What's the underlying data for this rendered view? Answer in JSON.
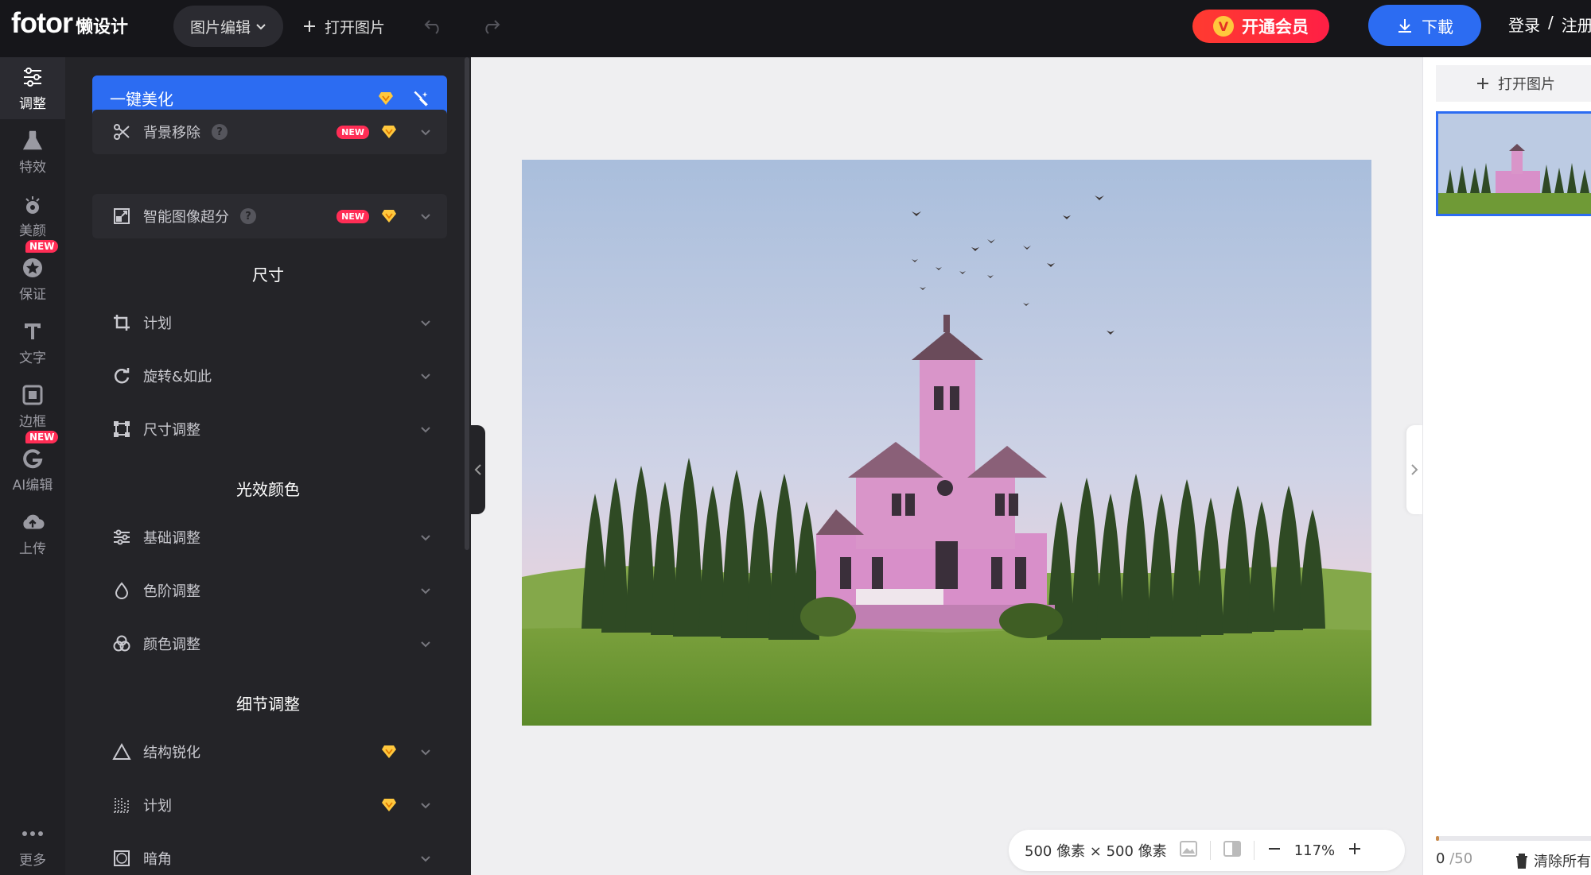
{
  "topbar": {
    "logo_brand": "fotor",
    "logo_sub": "懒设计",
    "menu_label": "图片编辑",
    "open_label": "打开图片",
    "vip_label": "开通会员",
    "download_label": "下載",
    "login_label": "登录",
    "sep": "/",
    "register_label": "注册"
  },
  "rail": {
    "items": [
      {
        "label": "调整",
        "icon": "sliders-icon"
      },
      {
        "label": "特效",
        "icon": "flask-icon"
      },
      {
        "label": "美颜",
        "icon": "eye-icon"
      },
      {
        "label": "保证",
        "icon": "star-badge-icon",
        "badge": "NEW"
      },
      {
        "label": "文字",
        "icon": "text-icon"
      },
      {
        "label": "边框",
        "icon": "frame-icon"
      },
      {
        "label": "AI编辑",
        "icon": "ai-icon",
        "badge": "NEW"
      },
      {
        "label": "上传",
        "icon": "cloud-upload-icon"
      },
      {
        "label": "更多",
        "icon": "more-icon"
      }
    ]
  },
  "panel": {
    "one_key": "一键美化",
    "cards": [
      {
        "label": "背景移除",
        "tag": "NEW"
      },
      {
        "label": "智能图像超分",
        "tag": "NEW"
      }
    ],
    "sections": {
      "size": "尺寸",
      "light": "光效颜色",
      "detail": "细节调整"
    },
    "size_rows": [
      "计划",
      "旋转&如此",
      "尺寸调整"
    ],
    "light_rows": [
      "基础调整",
      "色阶调整",
      "颜色调整"
    ],
    "detail_rows": [
      "结构锐化",
      "计划",
      "暗角"
    ]
  },
  "infobar": {
    "dims": "500 像素 × 500 像素",
    "zoom": "117%"
  },
  "right": {
    "open_label": "打开图片",
    "count": "0",
    "total": "/50",
    "clear_label": "清除所有",
    "progress_fraction": 0.02
  },
  "colors": {
    "accent": "#2c6cf2",
    "vip_red": "#ff1f45",
    "premium_gold": "#ffc83d",
    "panel_bg": "#242428"
  }
}
